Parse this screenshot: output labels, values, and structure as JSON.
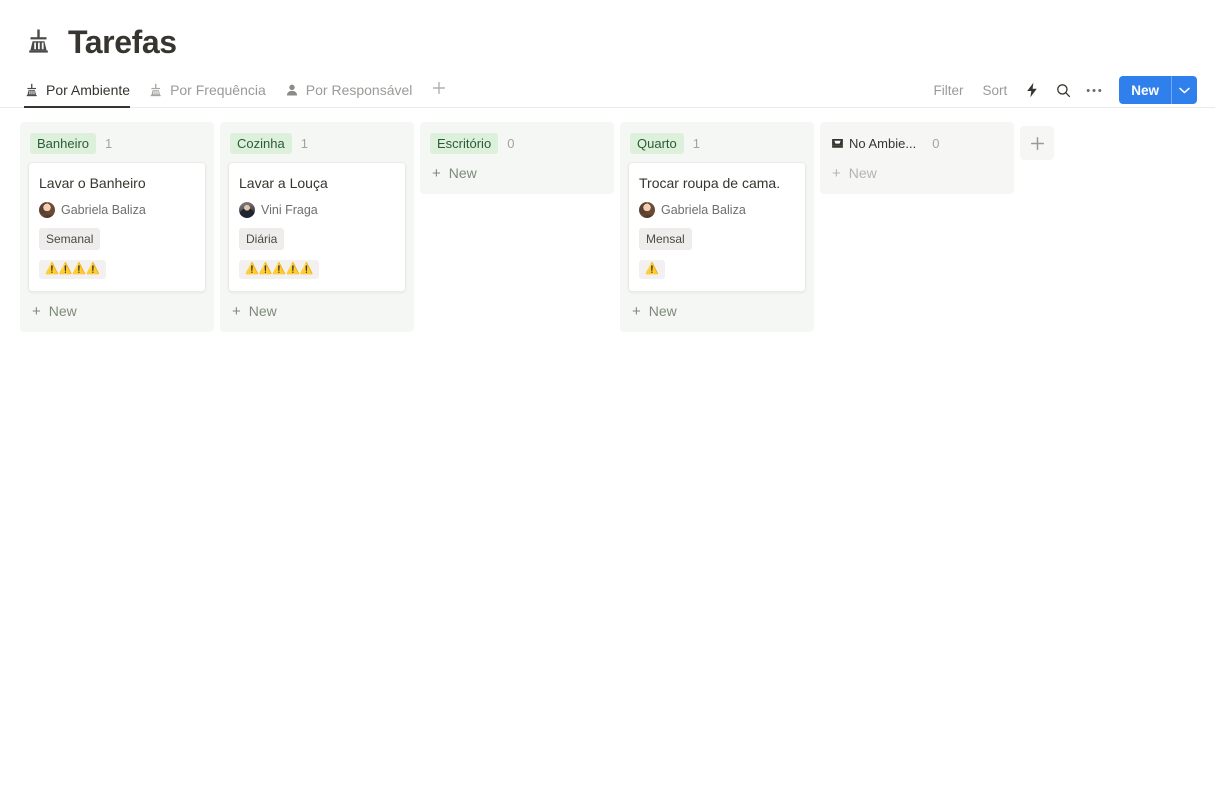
{
  "header": {
    "icon": "broom-icon",
    "title": "Tarefas"
  },
  "tabs": [
    {
      "label": "Por Ambiente",
      "icon": "broom-icon",
      "active": true
    },
    {
      "label": "Por Frequência",
      "icon": "broom-icon",
      "active": false
    },
    {
      "label": "Por Responsável",
      "icon": "person-icon",
      "active": false
    }
  ],
  "tab_add": {
    "icon": "plus-icon"
  },
  "toolbar": {
    "filter_label": "Filter",
    "sort_label": "Sort",
    "automation_icon": "lightning-icon",
    "search_icon": "search-icon",
    "more_icon": "ellipsis-icon",
    "new_label": "New",
    "new_caret_icon": "chevron-down-icon",
    "new_color": "#2f80ed"
  },
  "board": {
    "new_label": "New",
    "new_plus": "+",
    "add_column_icon": "plus-icon",
    "chip_bg": "#dcf0dc",
    "chip_color": "#2c5c34",
    "columns": [
      {
        "name": "Banheiro",
        "count": "1",
        "icon": null,
        "muted": false,
        "cards": [
          {
            "title": "Lavar o Banheiro",
            "person": "Gabriela Baliza",
            "avatar": "gabriela-avatar",
            "tag": "Semanal",
            "emojis": "⚠️⚠️⚠️⚠️"
          }
        ]
      },
      {
        "name": "Cozinha",
        "count": "1",
        "icon": null,
        "muted": false,
        "cards": [
          {
            "title": "Lavar a Louça",
            "person": "Vini Fraga",
            "avatar": "vini-avatar",
            "tag": "Diária",
            "emojis": "⚠️⚠️⚠️⚠️⚠️"
          }
        ]
      },
      {
        "name": "Escritório",
        "count": "0",
        "icon": null,
        "muted": false,
        "cards": []
      },
      {
        "name": "Quarto",
        "count": "1",
        "icon": null,
        "muted": false,
        "cards": [
          {
            "title": "Trocar roupa de cama.",
            "person": "Gabriela Baliza",
            "avatar": "gabriela-avatar",
            "tag": "Mensal",
            "emojis": "⚠️"
          }
        ]
      },
      {
        "name": "No Ambie...",
        "count": "0",
        "icon": "inbox-icon",
        "muted": true,
        "cards": []
      }
    ]
  }
}
